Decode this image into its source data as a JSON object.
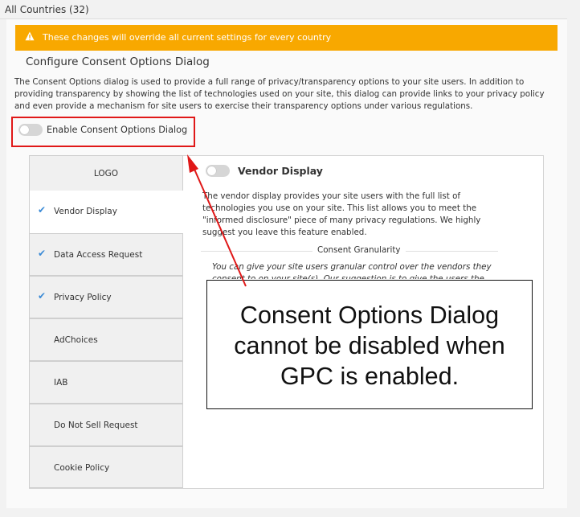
{
  "header": {
    "title": "All Countries (32)"
  },
  "warning": {
    "icon": "warning-icon",
    "text": "These changes will override all current settings for every country",
    "color": "#f8a800"
  },
  "section": {
    "title": "Configure Consent Options Dialog",
    "description": "The Consent Options dialog is used to provide a full range of privacy/transparency options to your site users. In addition to providing transparency by showing the list of technologies used on your site, this dialog can provide links to your privacy policy and even provide a mechanism for site users to exercise their transparency options under various regulations."
  },
  "enable_toggle": {
    "label": "Enable Consent Options Dialog",
    "state": "off"
  },
  "nav": {
    "items": [
      {
        "label": "LOGO",
        "checked": false
      },
      {
        "label": "Vendor Display",
        "checked": true,
        "active": true
      },
      {
        "label": "Data Access Request",
        "checked": true
      },
      {
        "label": "Privacy Policy",
        "checked": true
      },
      {
        "label": "AdChoices",
        "checked": false
      },
      {
        "label": "IAB",
        "checked": false
      },
      {
        "label": "Do Not Sell Request",
        "checked": false
      },
      {
        "label": "Cookie Policy",
        "checked": false
      }
    ]
  },
  "vendor": {
    "title": "Vendor Display",
    "toggle_state": "off",
    "description": "The vendor display provides your site users with the full list of technologies you use on your site. This list allows you to meet the \"informed disclosure\" piece of many privacy regulations. We highly suggest you leave this feature enabled.",
    "granularity_label": "Consent Granularity",
    "granularity_text": "You can give your site users granular control over the vendors they consent to on your site(s). Our suggestion is to give the users the ability to"
  },
  "callout": {
    "lines": [
      "Consent Options Dialog",
      "cannot be disabled when",
      "GPC is enabled."
    ]
  },
  "colors": {
    "accent_red": "#e01818",
    "check_blue": "#3a8ad6"
  }
}
